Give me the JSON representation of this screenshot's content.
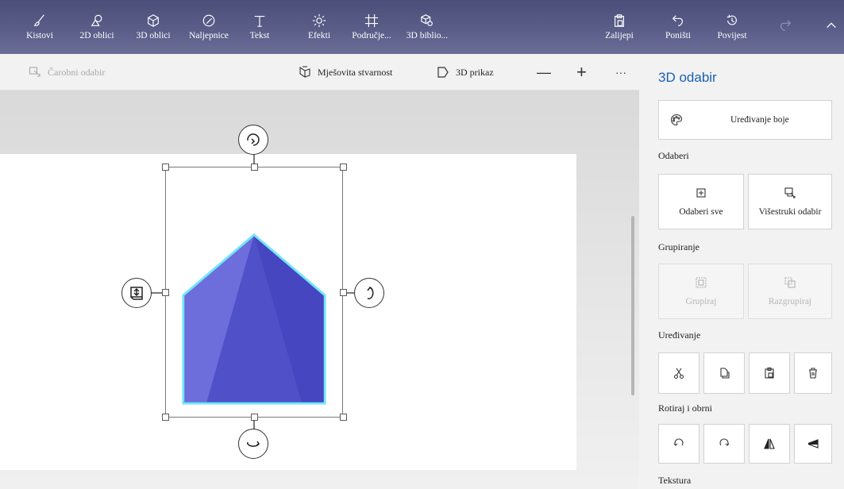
{
  "toolbar": {
    "tools": [
      {
        "id": "kistovi",
        "label": "Kistovi",
        "icon": "brush-icon"
      },
      {
        "id": "2d",
        "label": "2D oblici",
        "icon": "2d-shapes-icon"
      },
      {
        "id": "3d",
        "label": "3D oblici",
        "icon": "3d-shapes-icon"
      },
      {
        "id": "stickers",
        "label": "Naljepnice",
        "icon": "sticker-icon"
      },
      {
        "id": "text",
        "label": "Tekst",
        "icon": "text-icon"
      },
      {
        "id": "effects",
        "label": "Efekti",
        "icon": "effects-icon"
      },
      {
        "id": "canvas",
        "label": "Područje...",
        "icon": "canvas-icon"
      },
      {
        "id": "library",
        "label": "3D biblio...",
        "icon": "3d-library-icon"
      }
    ],
    "paste_label": "Zalijepi",
    "undo_label": "Poništi",
    "history_label": "Povijest"
  },
  "subbar": {
    "magic_select": "Čarobni odabir",
    "mixed_reality": "Mješovita stvarnost",
    "view_3d": "3D prikaz",
    "zoom_out": "—",
    "zoom_in": "+",
    "more": "···"
  },
  "panel": {
    "title": "3D odabir",
    "edit_color": "Uređivanje boje",
    "select_section": "Odaberi",
    "select_all": "Odaberi sve",
    "multi_select": "Višestruki odabir",
    "group_section": "Grupiranje",
    "group": "Grupiraj",
    "ungroup": "Razgrupiraj",
    "edit_section": "Uređivanje",
    "rotate_section": "Rotiraj i obrni",
    "texture_section": "Tekstura"
  },
  "colors": {
    "accent": "#1b5fb4",
    "shape_light": "#6a6ad8",
    "shape_dark": "#4b4bc4",
    "shape_outline": "#5fe0f5"
  }
}
